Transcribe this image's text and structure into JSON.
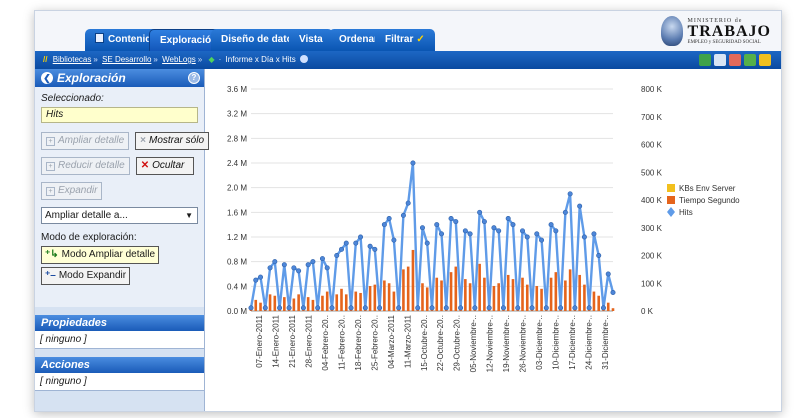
{
  "tabs": [
    {
      "label": "Contenido"
    },
    {
      "label": "Exploración"
    },
    {
      "label": "Diseño de datos"
    },
    {
      "label": "Vista"
    },
    {
      "label": "Ordenar"
    },
    {
      "label": "Filtrar"
    }
  ],
  "logo": {
    "top": "MINISTERIO de",
    "main": "TRABAJO",
    "sub": "EMPLEO y SEGURIDAD SOCIAL"
  },
  "breadcrumb": {
    "items": [
      "Bibliotecas",
      "SE Desarrollo",
      "WebLogs"
    ],
    "report": "Informe x Día x Hits"
  },
  "exploration": {
    "title": "Exploración",
    "selected_label": "Seleccionado:",
    "selected_value": "Hits",
    "ampliar_detalle": "Ampliar detalle",
    "mostrar_solo": "Mostrar sólo",
    "reducir_detalle": "Reducir detalle",
    "ocultar": "Ocultar",
    "expandir": "Expandir",
    "dropdown_value": "Ampliar detalle a...",
    "mode_label": "Modo de exploración:",
    "mode_ampliar": "Modo Ampliar detalle",
    "mode_expandir": "Modo Expandir"
  },
  "propiedades": {
    "title": "Propiedades",
    "value": "[ ninguno ]"
  },
  "acciones": {
    "title": "Acciones",
    "value": "[ ninguno ]"
  },
  "colors": {
    "blue_line": "#5f9be8",
    "orange_bar": "#e5641c",
    "yellow": "#f2c01e"
  },
  "chart_data": {
    "type": "line",
    "left_axis": {
      "ticks": [
        "0.0 M",
        "0.4 M",
        "0.8 M",
        "1.2 M",
        "1.6 M",
        "2.0 M",
        "2.4 M",
        "2.8 M",
        "3.2 M",
        "3.6 M"
      ],
      "range": [
        0,
        3.6
      ]
    },
    "right_axis": {
      "ticks": [
        "0 K",
        "100 K",
        "200 K",
        "300 K",
        "400 K",
        "500 K",
        "600 K",
        "700 K",
        "800 K"
      ],
      "range": [
        0,
        800
      ]
    },
    "categories": [
      "07-Enero-2011",
      "14-Enero-2011",
      "21-Enero-2011",
      "28-Enero-2011",
      "04-Febrero-20..",
      "11-Febrero-20..",
      "18-Febrero-20..",
      "25-Febrero-20..",
      "04-Marzo-2011",
      "11-Marzo-2011",
      "15-Octubre-20..",
      "22-Octubre-20..",
      "29-Octubre-20..",
      "05-Noviembre-..",
      "12-Noviembre-..",
      "19-Noviembre-..",
      "26-Noviembre-..",
      "03-Diciembre-..",
      "10-Diciembre-..",
      "17-Diciembre-..",
      "24-Diciembre-..",
      "31-Diciembre-.."
    ],
    "legend": [
      "KBs Env Server",
      "Tiempo Segundo",
      "Hits"
    ],
    "legend_position": "right",
    "series": [
      {
        "name": "Hits",
        "values": [
          0.05,
          0.5,
          0.55,
          0.05,
          0.7,
          0.8,
          0.05,
          0.75,
          0.05,
          0.7,
          0.65,
          0.05,
          0.75,
          0.8,
          0.05,
          0.85,
          0.7,
          0.05,
          0.9,
          1.0,
          1.1,
          0.05,
          1.1,
          1.2,
          0.05,
          1.05,
          1.0,
          0.05,
          1.4,
          1.5,
          1.15,
          0.05,
          1.55,
          1.75,
          2.4,
          0.05,
          1.35,
          1.1,
          0.05,
          1.4,
          1.25,
          0.05,
          1.5,
          1.45,
          0.05,
          1.3,
          1.25,
          0.05,
          1.6,
          1.45,
          0.05,
          1.35,
          1.3,
          0.05,
          1.5,
          1.4,
          0.05,
          1.3,
          1.2,
          0.05,
          1.25,
          1.15,
          0.05,
          1.4,
          1.3,
          0.05,
          1.6,
          1.9,
          0.05,
          1.7,
          1.2,
          0.05,
          1.25,
          0.9,
          0.05,
          0.6,
          0.3
        ]
      },
      {
        "name": "Tiempo Segundo",
        "values": [
          5,
          40,
          30,
          5,
          60,
          55,
          5,
          50,
          5,
          45,
          60,
          5,
          50,
          40,
          5,
          55,
          70,
          5,
          60,
          80,
          60,
          5,
          70,
          65,
          5,
          90,
          95,
          5,
          110,
          100,
          70,
          5,
          150,
          160,
          220,
          5,
          100,
          85,
          5,
          120,
          110,
          5,
          140,
          160,
          5,
          115,
          100,
          5,
          170,
          120,
          5,
          90,
          100,
          5,
          130,
          115,
          5,
          120,
          95,
          5,
          90,
          80,
          5,
          120,
          140,
          5,
          110,
          150,
          5,
          130,
          95,
          5,
          70,
          55,
          5,
          30,
          10
        ]
      }
    ]
  }
}
